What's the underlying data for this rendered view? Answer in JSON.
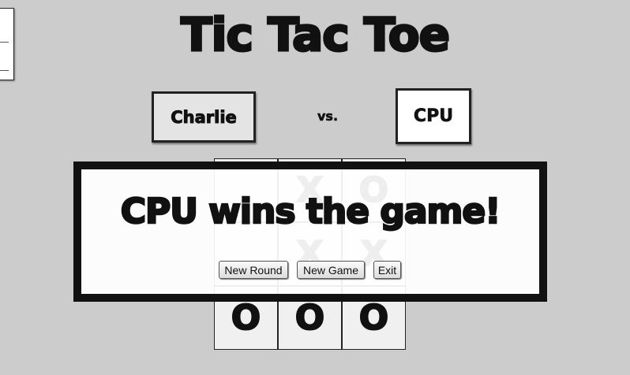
{
  "game": {
    "title": "Tic Tac Toe",
    "player1": "Charlie",
    "vs": "vs.",
    "player2": "CPU",
    "board": [
      "",
      "X",
      "O",
      "",
      "X",
      "X",
      "O",
      "O",
      "O"
    ]
  },
  "result": {
    "message": "CPU wins the game!",
    "buttons": {
      "new_round": "New Round",
      "new_game": "New Game",
      "exit": "Exit"
    }
  }
}
